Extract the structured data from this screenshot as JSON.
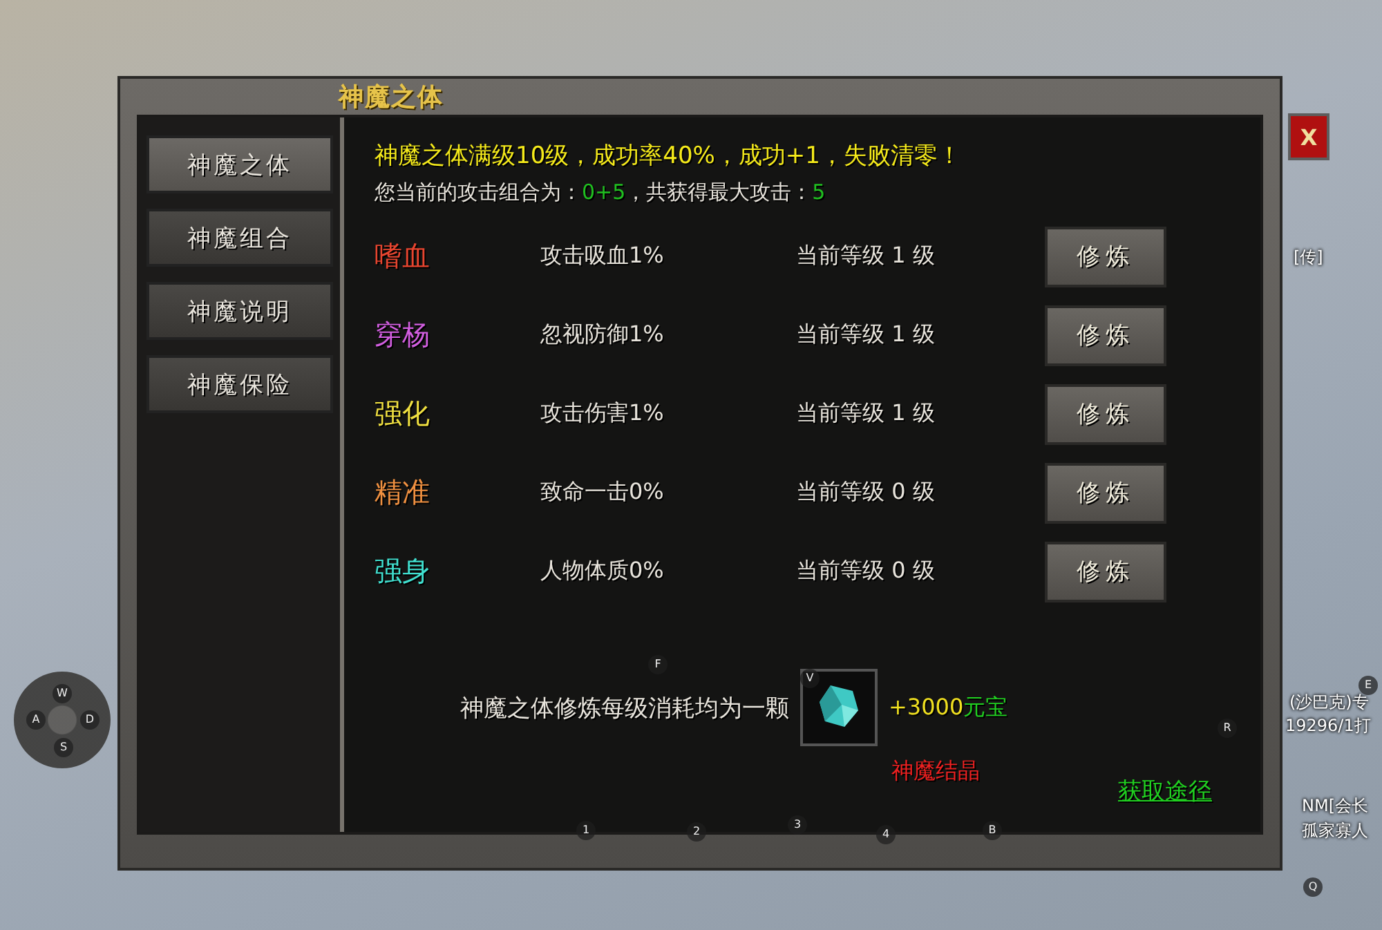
{
  "window": {
    "title": "神魔之体",
    "close": "X"
  },
  "sidebar": {
    "items": [
      {
        "label": "神魔之体",
        "selected": true
      },
      {
        "label": "神魔组合",
        "selected": false
      },
      {
        "label": "神魔说明",
        "selected": false
      },
      {
        "label": "神魔保险",
        "selected": false
      }
    ]
  },
  "info": {
    "rule": "神魔之体满级10级，成功率40%，成功+1，失败清零！",
    "combo_label": "您当前的攻击组合为：",
    "combo_value": "0+5",
    "max_label": "，共获得最大攻击：",
    "max_value": "5"
  },
  "attributes": [
    {
      "name": "嗜血",
      "color": "#e8452f",
      "effect": "攻击吸血1%",
      "grade": "当前等级 1 级",
      "button": "修炼"
    },
    {
      "name": "穿杨",
      "color": "#d25ee0",
      "effect": "忽视防御1%",
      "grade": "当前等级 1 级",
      "button": "修炼"
    },
    {
      "name": "强化",
      "color": "#f0e040",
      "effect": "攻击伤害1%",
      "grade": "当前等级 1 级",
      "button": "修炼"
    },
    {
      "name": "精准",
      "color": "#f09040",
      "effect": "致命一击0%",
      "grade": "当前等级 0 级",
      "button": "修炼"
    },
    {
      "name": "强身",
      "color": "#40e0d0",
      "effect": "人物体质0%",
      "grade": "当前等级 0 级",
      "button": "修炼"
    }
  ],
  "cost": {
    "text": "神魔之体修炼每级消耗均为一颗",
    "price_amount": "+3000",
    "price_currency": "元宝",
    "item_name": "神魔结晶",
    "link": "获取途径"
  },
  "key_hints": [
    "W",
    "A",
    "D",
    "S",
    "F",
    "V",
    "R",
    "1",
    "2",
    "3",
    "4",
    "B",
    "E",
    "Q"
  ],
  "scene_labels": [
    "[传]",
    "(沙巴克)专",
    "19296/1打",
    "NM[会长",
    "孤家寡人"
  ]
}
